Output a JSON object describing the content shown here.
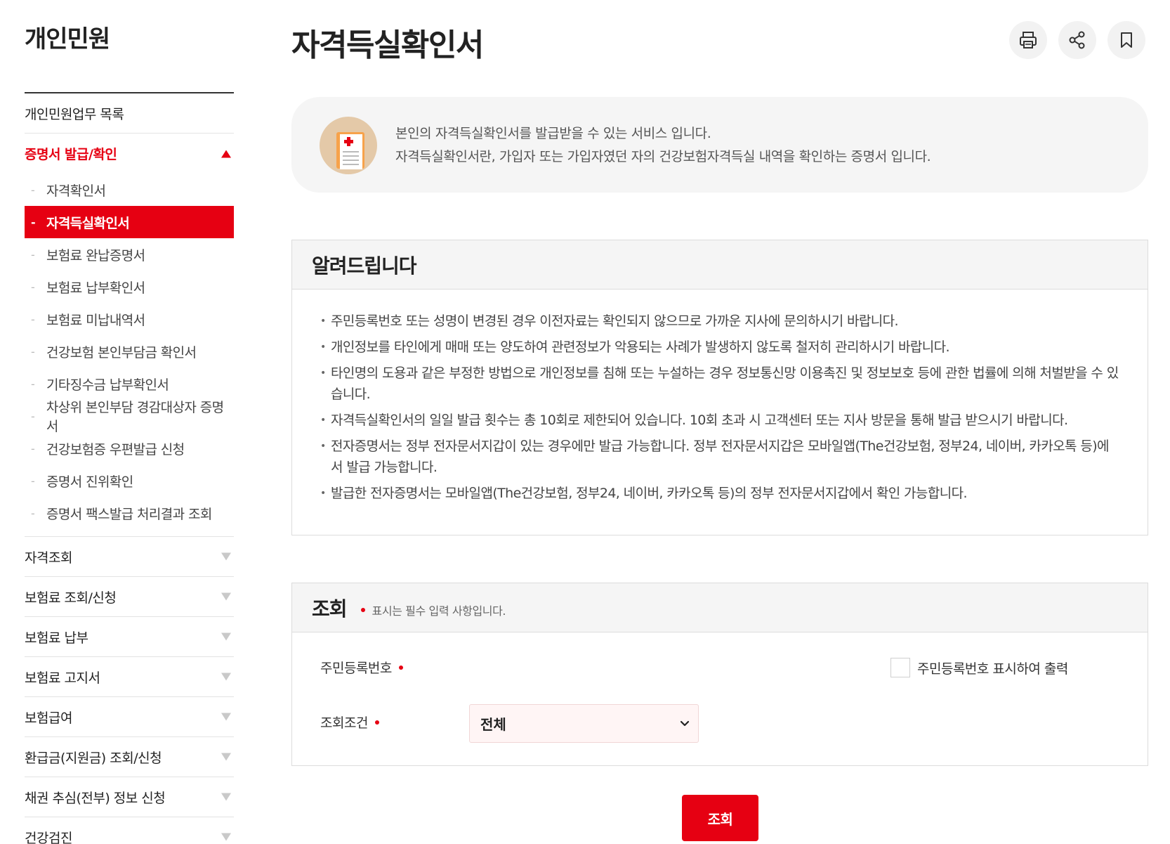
{
  "sidebar": {
    "title": "개인민원",
    "items_top": [
      {
        "label": "개인민원업무 목록"
      },
      {
        "label": "증명서 발급/확인"
      }
    ],
    "subitems": [
      {
        "label": "자격확인서"
      },
      {
        "label": "자격득실확인서"
      },
      {
        "label": "보험료 완납증명서"
      },
      {
        "label": "보험료 납부확인서"
      },
      {
        "label": "보험료 미납내역서"
      },
      {
        "label": "건강보험 본인부담금 확인서"
      },
      {
        "label": "기타징수금 납부확인서"
      },
      {
        "label": "차상위 본인부담 경감대상자 증명서"
      },
      {
        "label": "건강보험증 우편발급 신청"
      },
      {
        "label": "증명서 진위확인"
      },
      {
        "label": "증명서 팩스발급 처리결과 조회"
      }
    ],
    "items_bottom": [
      {
        "label": "자격조회"
      },
      {
        "label": "보험료 조회/신청"
      },
      {
        "label": "보험료 납부"
      },
      {
        "label": "보험료 고지서"
      },
      {
        "label": "보험급여"
      },
      {
        "label": "환급금(지원금) 조회/신청"
      },
      {
        "label": "채권 추심(전부) 정보 신청"
      },
      {
        "label": "건강검진"
      }
    ],
    "sub_dash": "-"
  },
  "page": {
    "title": "자격득실확인서"
  },
  "toolbar": {
    "print_icon": "printer-icon",
    "share_icon": "share-icon",
    "bookmark_icon": "bookmark-icon"
  },
  "intro": {
    "line1": "본인의 자격득실확인서를 발급받을 수 있는 서비스 입니다.",
    "line2": "자격득실확인서란, 가입자 또는 가입자였던 자의 건강보험자격득실 내역을 확인하는 증명서 입니다."
  },
  "notice": {
    "title": "알려드립니다",
    "items": [
      "주민등록번호 또는 성명이 변경된 경우 이전자료는 확인되지 않으므로 가까운 지사에 문의하시기 바랍니다.",
      "개인정보를 타인에게 매매 또는 양도하여 관련정보가 악용되는 사례가 발생하지 않도록 철저히 관리하시기 바랍니다.",
      "타인명의 도용과 같은 부정한 방법으로 개인정보를 침해 또는 누설하는 경우 정보통신망 이용촉진 및 정보보호 등에 관한 법률에 의해 처벌받을 수 있습니다.",
      "자격득실확인서의 일일 발급 횟수는 총 10회로 제한되어 있습니다. 10회 초과 시 고객센터 또는 지사 방문을 통해 발급 받으시기 바랍니다.",
      "전자증명서는 정부 전자문서지갑이 있는 경우에만 발급 가능합니다. 정부 전자문서지갑은 모바일앱(The건강보험, 정부24, 네이버, 카카오톡 등)에서 발급 가능합니다.",
      "발급한 전자증명서는 모바일앱(The건강보험, 정부24, 네이버, 카카오톡 등)의 정부 전자문서지갑에서 확인 가능합니다."
    ]
  },
  "search": {
    "title": "조회",
    "required_note": "표시는 필수 입력 사항입니다.",
    "rrn_label": "주민등록번호",
    "show_rrn_label": "주민등록번호 표시하여 출력",
    "condition_label": "조회조건",
    "condition_value": "전체",
    "submit_label": "조회"
  },
  "colors": {
    "accent": "#e60012",
    "panel_bg": "#f5f5f5",
    "border": "#dcdcdc"
  }
}
